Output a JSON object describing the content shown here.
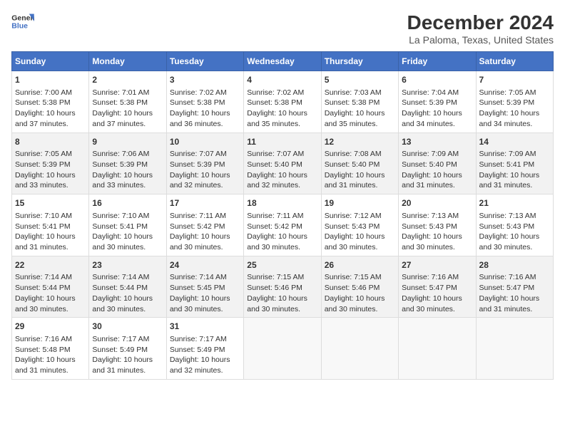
{
  "logo": {
    "line1": "General",
    "line2": "Blue"
  },
  "title": "December 2024",
  "subtitle": "La Paloma, Texas, United States",
  "days_of_week": [
    "Sunday",
    "Monday",
    "Tuesday",
    "Wednesday",
    "Thursday",
    "Friday",
    "Saturday"
  ],
  "weeks": [
    [
      {
        "day": "1",
        "sunrise": "7:00 AM",
        "sunset": "5:38 PM",
        "daylight": "10 hours and 37 minutes."
      },
      {
        "day": "2",
        "sunrise": "7:01 AM",
        "sunset": "5:38 PM",
        "daylight": "10 hours and 37 minutes."
      },
      {
        "day": "3",
        "sunrise": "7:02 AM",
        "sunset": "5:38 PM",
        "daylight": "10 hours and 36 minutes."
      },
      {
        "day": "4",
        "sunrise": "7:02 AM",
        "sunset": "5:38 PM",
        "daylight": "10 hours and 35 minutes."
      },
      {
        "day": "5",
        "sunrise": "7:03 AM",
        "sunset": "5:38 PM",
        "daylight": "10 hours and 35 minutes."
      },
      {
        "day": "6",
        "sunrise": "7:04 AM",
        "sunset": "5:39 PM",
        "daylight": "10 hours and 34 minutes."
      },
      {
        "day": "7",
        "sunrise": "7:05 AM",
        "sunset": "5:39 PM",
        "daylight": "10 hours and 34 minutes."
      }
    ],
    [
      {
        "day": "8",
        "sunrise": "7:05 AM",
        "sunset": "5:39 PM",
        "daylight": "10 hours and 33 minutes."
      },
      {
        "day": "9",
        "sunrise": "7:06 AM",
        "sunset": "5:39 PM",
        "daylight": "10 hours and 33 minutes."
      },
      {
        "day": "10",
        "sunrise": "7:07 AM",
        "sunset": "5:39 PM",
        "daylight": "10 hours and 32 minutes."
      },
      {
        "day": "11",
        "sunrise": "7:07 AM",
        "sunset": "5:40 PM",
        "daylight": "10 hours and 32 minutes."
      },
      {
        "day": "12",
        "sunrise": "7:08 AM",
        "sunset": "5:40 PM",
        "daylight": "10 hours and 31 minutes."
      },
      {
        "day": "13",
        "sunrise": "7:09 AM",
        "sunset": "5:40 PM",
        "daylight": "10 hours and 31 minutes."
      },
      {
        "day": "14",
        "sunrise": "7:09 AM",
        "sunset": "5:41 PM",
        "daylight": "10 hours and 31 minutes."
      }
    ],
    [
      {
        "day": "15",
        "sunrise": "7:10 AM",
        "sunset": "5:41 PM",
        "daylight": "10 hours and 31 minutes."
      },
      {
        "day": "16",
        "sunrise": "7:10 AM",
        "sunset": "5:41 PM",
        "daylight": "10 hours and 30 minutes."
      },
      {
        "day": "17",
        "sunrise": "7:11 AM",
        "sunset": "5:42 PM",
        "daylight": "10 hours and 30 minutes."
      },
      {
        "day": "18",
        "sunrise": "7:11 AM",
        "sunset": "5:42 PM",
        "daylight": "10 hours and 30 minutes."
      },
      {
        "day": "19",
        "sunrise": "7:12 AM",
        "sunset": "5:43 PM",
        "daylight": "10 hours and 30 minutes."
      },
      {
        "day": "20",
        "sunrise": "7:13 AM",
        "sunset": "5:43 PM",
        "daylight": "10 hours and 30 minutes."
      },
      {
        "day": "21",
        "sunrise": "7:13 AM",
        "sunset": "5:43 PM",
        "daylight": "10 hours and 30 minutes."
      }
    ],
    [
      {
        "day": "22",
        "sunrise": "7:14 AM",
        "sunset": "5:44 PM",
        "daylight": "10 hours and 30 minutes."
      },
      {
        "day": "23",
        "sunrise": "7:14 AM",
        "sunset": "5:44 PM",
        "daylight": "10 hours and 30 minutes."
      },
      {
        "day": "24",
        "sunrise": "7:14 AM",
        "sunset": "5:45 PM",
        "daylight": "10 hours and 30 minutes."
      },
      {
        "day": "25",
        "sunrise": "7:15 AM",
        "sunset": "5:46 PM",
        "daylight": "10 hours and 30 minutes."
      },
      {
        "day": "26",
        "sunrise": "7:15 AM",
        "sunset": "5:46 PM",
        "daylight": "10 hours and 30 minutes."
      },
      {
        "day": "27",
        "sunrise": "7:16 AM",
        "sunset": "5:47 PM",
        "daylight": "10 hours and 30 minutes."
      },
      {
        "day": "28",
        "sunrise": "7:16 AM",
        "sunset": "5:47 PM",
        "daylight": "10 hours and 31 minutes."
      }
    ],
    [
      {
        "day": "29",
        "sunrise": "7:16 AM",
        "sunset": "5:48 PM",
        "daylight": "10 hours and 31 minutes."
      },
      {
        "day": "30",
        "sunrise": "7:17 AM",
        "sunset": "5:49 PM",
        "daylight": "10 hours and 31 minutes."
      },
      {
        "day": "31",
        "sunrise": "7:17 AM",
        "sunset": "5:49 PM",
        "daylight": "10 hours and 32 minutes."
      },
      null,
      null,
      null,
      null
    ]
  ],
  "labels": {
    "sunrise": "Sunrise:",
    "sunset": "Sunset:",
    "daylight": "Daylight:"
  }
}
